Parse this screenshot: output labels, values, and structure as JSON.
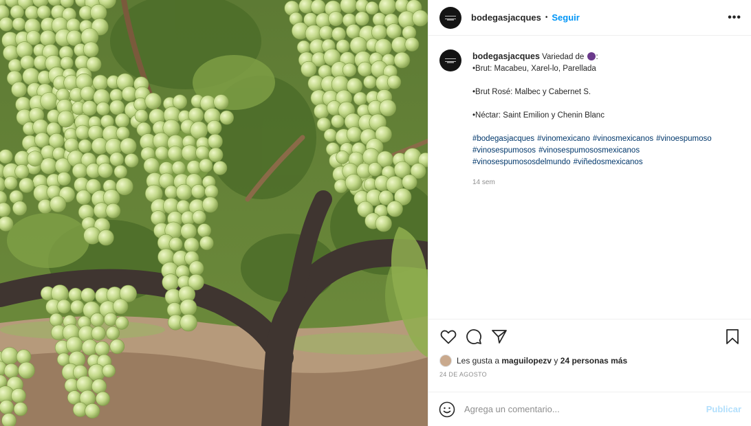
{
  "post": {
    "username": "bodegasjacques",
    "dot": "•",
    "follow_label": "Seguir",
    "more_icon": "more-options-icon",
    "more_glyph": "•••",
    "photo_alt": "grapevine-photo"
  },
  "caption": {
    "username": "bodegasjacques",
    "intro": "Variedad de",
    "intro_end": ":",
    "emoji_icon": "grape-emoji-icon",
    "lines": [
      "•Brut: Macabeu, Xarel-lo, Parellada",
      "•Brut Rosé: Malbec y Cabernet S.",
      "•Néctar: Saint Emilion y Chenin Blanc"
    ],
    "hashtags": [
      "#bodegasjacques",
      "#vinomexicano",
      "#vinosmexicanos",
      "#vinoespumoso",
      "#vinosespumosos",
      "#vinosespumososmexicanos",
      "#vinosespumososdelmundo",
      "#viñedosmexicanos"
    ],
    "time": "14 sem"
  },
  "actions": {
    "like_icon": "heart-icon",
    "comment_icon": "comment-icon",
    "share_icon": "share-icon",
    "save_icon": "bookmark-icon"
  },
  "likes": {
    "prefix": "Les gusta a",
    "user": "maguilopezv",
    "connector": "y",
    "others": "24 personas más"
  },
  "date": "24 DE AGOSTO",
  "comment": {
    "placeholder": "Agrega un comentario...",
    "publish_label": "Publicar",
    "emoji_icon": "smiley-icon"
  },
  "colors": {
    "accent": "#0095f6",
    "hashtag": "#00376b",
    "muted": "#8e8e8e",
    "publish_disabled": "#b2dffc"
  }
}
